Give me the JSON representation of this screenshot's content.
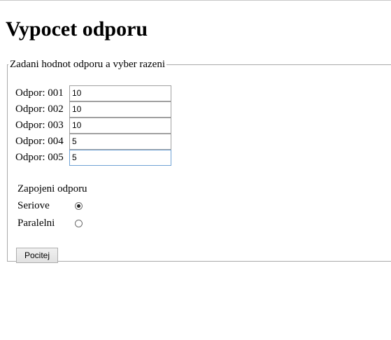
{
  "page": {
    "title": "Vypocet odporu"
  },
  "form": {
    "legend": "Zadani hodnot odporu a vyber razeni",
    "resistors": [
      {
        "label": "Odpor: 001",
        "value": "10"
      },
      {
        "label": "Odpor: 002",
        "value": "10"
      },
      {
        "label": "Odpor: 003",
        "value": "10"
      },
      {
        "label": "Odpor: 004",
        "value": "5"
      },
      {
        "label": "Odpor: 005",
        "value": "5"
      }
    ],
    "connection_label": "Zapojeni odporu",
    "options": [
      {
        "label": "Seriove",
        "checked": true
      },
      {
        "label": "Paralelni",
        "checked": false
      }
    ],
    "submit_label": "Pocitej"
  }
}
